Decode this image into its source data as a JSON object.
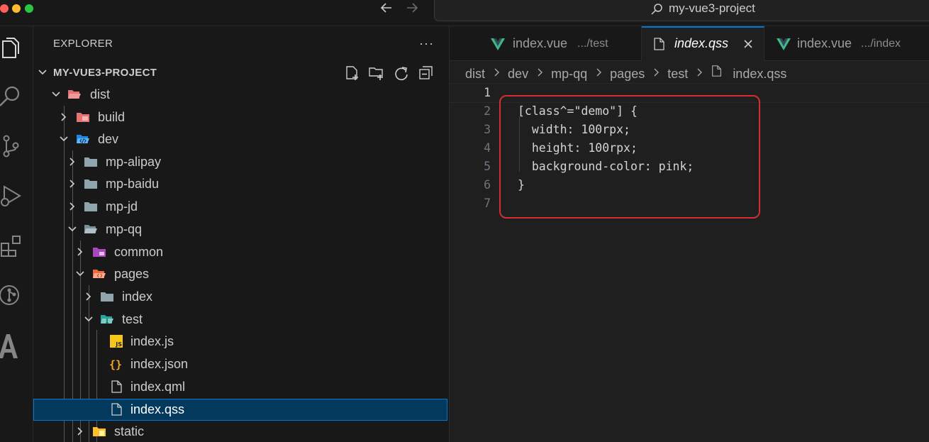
{
  "window": {
    "title": "my-vue3-project"
  },
  "sidebar": {
    "title": "EXPLORER",
    "more": "···",
    "root": "MY-VUE3-PROJECT",
    "tree": [
      {
        "label": "dist",
        "icon": "dist-folder-open-icon"
      },
      {
        "label": "build",
        "icon": "build-folder-icon"
      },
      {
        "label": "dev",
        "icon": "dev-folder-open-icon"
      },
      {
        "label": "mp-alipay",
        "icon": "folder-icon"
      },
      {
        "label": "mp-baidu",
        "icon": "folder-icon"
      },
      {
        "label": "mp-jd",
        "icon": "folder-icon"
      },
      {
        "label": "mp-qq",
        "icon": "folder-open-icon"
      },
      {
        "label": "common",
        "icon": "common-folder-icon"
      },
      {
        "label": "pages",
        "icon": "pages-folder-open-icon"
      },
      {
        "label": "index",
        "icon": "folder-icon"
      },
      {
        "label": "test",
        "icon": "test-folder-open-icon"
      },
      {
        "label": "index.js",
        "icon": "js-file-icon"
      },
      {
        "label": "index.json",
        "icon": "json-file-icon"
      },
      {
        "label": "index.qml",
        "icon": "file-icon"
      },
      {
        "label": "index.qss",
        "icon": "file-icon"
      },
      {
        "label": "static",
        "icon": "static-folder-icon"
      }
    ]
  },
  "tabs": [
    {
      "label": "index.vue",
      "description": ".../test",
      "icon": "vue-icon"
    },
    {
      "label": "index.qss",
      "description": "",
      "icon": "file-icon"
    },
    {
      "label": "index.vue",
      "description": ".../index",
      "icon": "vue-icon"
    }
  ],
  "breadcrumbs": [
    "dist",
    "dev",
    "mp-qq",
    "pages",
    "test",
    "index.qss"
  ],
  "editor": {
    "line_numbers": [
      "1",
      "2",
      "3",
      "4",
      "5",
      "6",
      "7"
    ],
    "lines": [
      "",
      "[class^=\"demo\"] {",
      "  width: 100rpx;",
      "  height: 100rpx;",
      "  background-color: pink;",
      "}",
      ""
    ]
  },
  "colors": {
    "accent": "#0078d4",
    "selection": "#04395e",
    "highlight_box": "#d32f2f",
    "vue": "#41b883"
  }
}
